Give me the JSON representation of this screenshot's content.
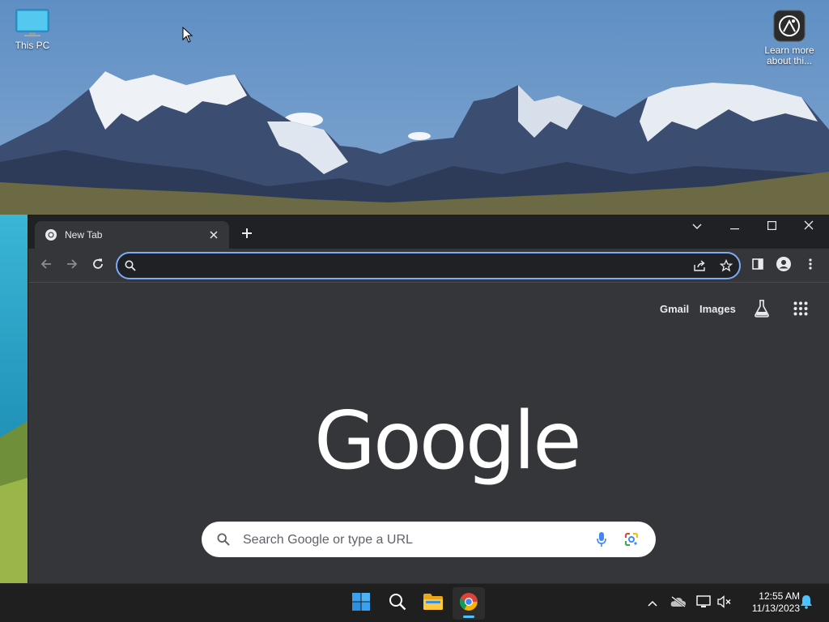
{
  "desktop": {
    "icons": [
      {
        "label": "This PC",
        "icon": "monitor-icon"
      },
      {
        "label": "Learn more about thi...",
        "icon": "spotlight-icon"
      }
    ]
  },
  "browser": {
    "tab": {
      "title": "New Tab",
      "icon": "chrome-icon"
    },
    "new_tab_icon": "plus-icon",
    "window_controls": [
      "chevron-down-icon",
      "minimize-icon",
      "maximize-icon",
      "close-icon"
    ],
    "omnibox": {
      "value": "",
      "placeholder": ""
    },
    "ntp": {
      "links": [
        "Gmail",
        "Images"
      ],
      "logo_text": "Google",
      "search_placeholder": "Search Google or type a URL"
    },
    "colors": {
      "frame": "#202124",
      "content": "#35363a",
      "focus_ring": "#7cacf8"
    }
  },
  "taskbar": {
    "apps": [
      "start-icon",
      "search-icon",
      "file-explorer-icon",
      "chrome-icon"
    ],
    "active_app": "chrome-icon",
    "tray": [
      "chevron-up-icon",
      "cloud-offline-icon",
      "network-icon",
      "volume-muted-icon"
    ],
    "time": "12:55 AM",
    "date": "11/13/2023",
    "accent": "#4cc2ff"
  }
}
